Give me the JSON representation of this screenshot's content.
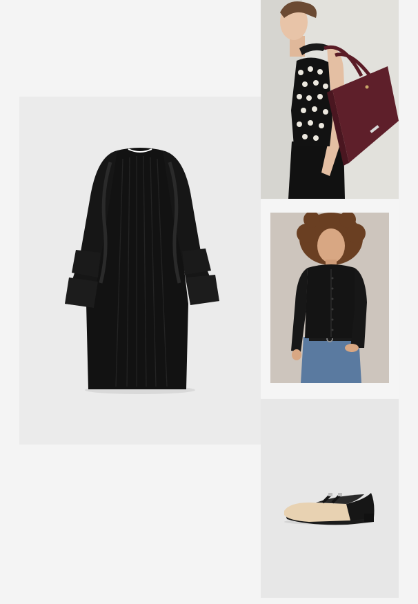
{
  "products": [
    {
      "id": "dress",
      "icon": "dress-photo",
      "background": "#ebebeb"
    },
    {
      "id": "bag",
      "icon": "model-with-tote-bag-photo",
      "background": "#dcdcd8"
    },
    {
      "id": "cardigan",
      "icon": "model-in-cardigan-photo",
      "background": "#cdc5bd"
    },
    {
      "id": "shoes",
      "icon": "mary-jane-flats-photo",
      "background": "#e7e7e7"
    }
  ],
  "colors": {
    "page_background": "#f4f4f4",
    "dress": "#111111",
    "bag": "#5e1f2a",
    "shoe_beige": "#e8d2b2",
    "shoe_black": "#161616"
  }
}
